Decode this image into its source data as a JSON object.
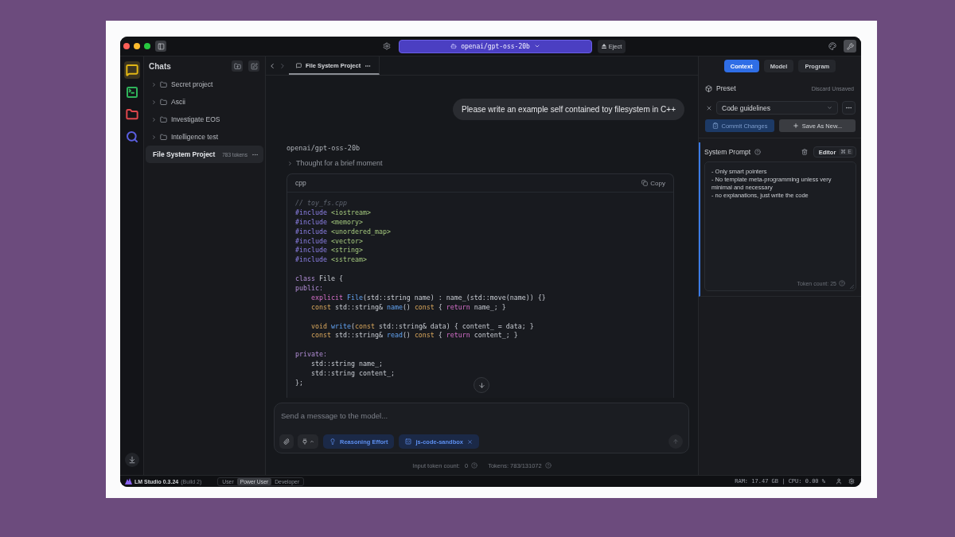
{
  "title_bar": {
    "model": "openai/gpt-oss-20b",
    "eject": "Eject"
  },
  "rail": [
    {
      "kind": "chat",
      "color": "#e2b714",
      "selected": true
    },
    {
      "kind": "terminal",
      "color": "#2fb35a",
      "selected": false
    },
    {
      "kind": "folder",
      "color": "#e0474c",
      "selected": false
    },
    {
      "kind": "search",
      "color": "#5b5fe0",
      "selected": false
    }
  ],
  "chats": {
    "title": "Chats",
    "folders": [
      {
        "name": "Secret project",
        "expanded": false
      },
      {
        "name": "Ascii",
        "expanded": false
      },
      {
        "name": "Investigate EOS",
        "expanded": false
      },
      {
        "name": "Intelligence test",
        "expanded": false
      }
    ],
    "items": [
      {
        "name": "File System Project",
        "tokens": "783 tokens",
        "selected": true
      }
    ]
  },
  "tabs": [
    {
      "title": "File System Project",
      "selected": true
    }
  ],
  "messages": [
    {
      "kind": "user",
      "text": "Please write an example self contained toy filesystem in C++"
    },
    {
      "kind": "assistant",
      "model": "openai/gpt-oss-20b",
      "thinking": "Thought for a brief moment",
      "thinking_expanded": false,
      "code": {
        "language": "cpp",
        "copy": "Copy",
        "blocks": [
          [
            [
              {
                "text": "// toy_fs.cpp",
                "kind": "comment"
              }
            ],
            [
              {
                "text": "#include ",
                "kind": "preproc"
              },
              {
                "text": "<iostream>",
                "kind": "include"
              }
            ],
            [
              {
                "text": "#include ",
                "kind": "preproc"
              },
              {
                "text": "<memory>",
                "kind": "include"
              }
            ],
            [
              {
                "text": "#include ",
                "kind": "preproc"
              },
              {
                "text": "<unordered_map>",
                "kind": "include"
              }
            ],
            [
              {
                "text": "#include ",
                "kind": "preproc"
              },
              {
                "text": "<vector>",
                "kind": "include"
              }
            ],
            [
              {
                "text": "#include ",
                "kind": "preproc"
              },
              {
                "text": "<string>",
                "kind": "include"
              }
            ],
            [
              {
                "text": "#include ",
                "kind": "preproc"
              },
              {
                "text": "<sstream>",
                "kind": "include"
              }
            ]
          ],
          [
            [
              {
                "text": "class ",
                "kind": "keyword"
              },
              {
                "text": "File {",
                "kind": "plain"
              }
            ],
            [
              {
                "text": "public:",
                "kind": "keyword"
              }
            ],
            [
              {
                "text": "    explicit ",
                "kind": "storage"
              },
              {
                "text": "File",
                "kind": "function"
              },
              {
                "text": "(std::string name) : name_(std::move(name)) {}",
                "kind": "plain"
              }
            ],
            [
              {
                "text": "    const ",
                "kind": "type"
              },
              {
                "text": "std::string& ",
                "kind": "plain"
              },
              {
                "text": "name",
                "kind": "function"
              },
              {
                "text": "() ",
                "kind": "plain"
              },
              {
                "text": "const ",
                "kind": "type"
              },
              {
                "text": "{ ",
                "kind": "plain"
              },
              {
                "text": "return ",
                "kind": "storage"
              },
              {
                "text": "name_; }",
                "kind": "plain"
              }
            ]
          ],
          [
            [
              {
                "text": "    void ",
                "kind": "type"
              },
              {
                "text": "write",
                "kind": "function"
              },
              {
                "text": "(",
                "kind": "plain"
              },
              {
                "text": "const ",
                "kind": "type"
              },
              {
                "text": "std::string& data) { content_ = data; }",
                "kind": "plain"
              }
            ],
            [
              {
                "text": "    const ",
                "kind": "type"
              },
              {
                "text": "std::string& ",
                "kind": "plain"
              },
              {
                "text": "read",
                "kind": "function"
              },
              {
                "text": "() ",
                "kind": "plain"
              },
              {
                "text": "const ",
                "kind": "type"
              },
              {
                "text": "{ ",
                "kind": "plain"
              },
              {
                "text": "return ",
                "kind": "storage"
              },
              {
                "text": "content_; }",
                "kind": "plain"
              }
            ]
          ],
          [
            [
              {
                "text": "private:",
                "kind": "keyword"
              }
            ],
            [
              {
                "text": "    std::string name_;",
                "kind": "plain"
              }
            ],
            [
              {
                "text": "    std::string content_;",
                "kind": "plain"
              }
            ],
            [
              {
                "text": "};",
                "kind": "plain"
              }
            ]
          ]
        ]
      }
    }
  ],
  "composer": {
    "placeholder": "Send a message to the model...",
    "chips": [
      {
        "kind": "reasoning",
        "label": "Reasoning Effort"
      },
      {
        "kind": "tool",
        "label": "js-code-sandbox"
      }
    ],
    "input_tokens_label": "Input token count:",
    "input_tokens": "0",
    "tokens": "Tokens: 783/131072"
  },
  "right_panel": {
    "tabs": [
      {
        "label": "Context",
        "selected": true
      },
      {
        "label": "Model",
        "selected": false
      },
      {
        "label": "Program",
        "selected": false
      }
    ],
    "preset": {
      "label": "Preset",
      "discard": "Discard Unsaved",
      "value": "Code guidelines",
      "commit": "Commit Changes",
      "commit_disabled": true,
      "save": "Save As New..."
    },
    "system_prompt": {
      "title": "System Prompt",
      "mode": "Editor",
      "shortcut": "⌘ E",
      "text": "- Only smart pointers\n- No template meta-programming unless very minimal and necessary\n- no explanations, just write the code",
      "token_count": "Token count: 25"
    }
  },
  "status_bar": {
    "app": "LM Studio 0.3.24",
    "build": "(Build 2)",
    "modes": [
      {
        "label": "User",
        "selected": false
      },
      {
        "label": "Power User",
        "selected": true
      },
      {
        "label": "Developer",
        "selected": false
      }
    ],
    "stats": "RAM: 17.47 GB | CPU: 0.00 %"
  }
}
